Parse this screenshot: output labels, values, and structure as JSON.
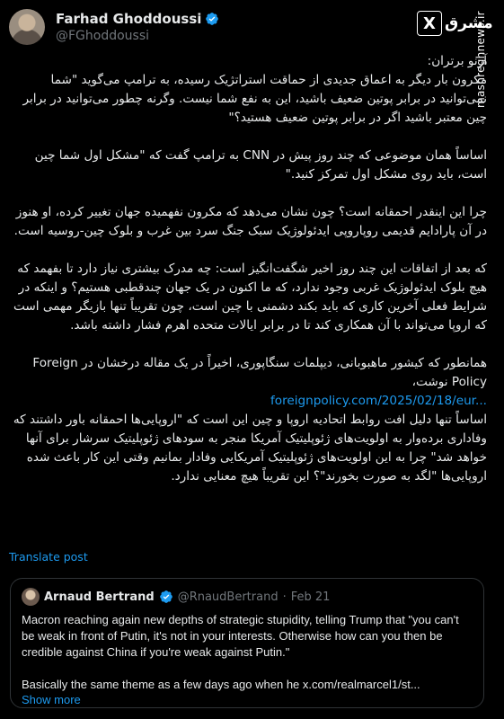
{
  "author": {
    "display_name": "Farhad Ghoddoussi",
    "handle": "@FGhoddoussi"
  },
  "watermark": {
    "x_logo": "X",
    "site_logo": "مشرق",
    "side_text": "mashreghnews.ir"
  },
  "tweet": {
    "paragraphs": [
      "آرنو برتران:",
      "مکرون بار دیگر به اعماق جدیدی از حماقت استراتژیک رسیده، به ترامپ می‌گوید \"شما نمی‌توانید در برابر پوتین ضعیف باشید، این به نفع شما نیست. وگرنه چطور می‌توانید در برابر چین معتبر باشید اگر در برابر پوتین ضعیف هستید؟\"",
      "اساساً همان موضوعی که چند روز پیش در CNN به ترامپ گفت که \"مشکل اول شما چین است، باید روی مشکل اول تمرکز کنید.\"",
      "چرا این اینقدر احمقانه است؟ چون نشان می‌دهد که مکرون نفهمیده جهان تغییر کرده، او هنوز در آن پارادایم قدیمی روپاروپی ایدئولوژیک سبک جنگ سرد بین غرب و بلوک چین-روسیه است.",
      "که بعد از اتفاقات این چند روز اخیر شگفت‌انگیز است: چه مدرک بیشتری نیاز دارد تا بفهمد که هیچ بلوک ایدئولوژیک غربی وجود ندارد، که ما اکنون در یک جهان چندقطبی هستیم؟ و اینکه در شرایط فعلی آخرین کاری که باید بکند دشمنی با چین است، چون تقریباً تنها بازیگر مهمی است که اروپا می‌تواند با آن همکاری کند تا در برابر ایالات متحده اهرم فشار داشته باشد.",
      "همانطور که کیشور ماهبوبانی، دیپلمات سنگاپوری، اخیراً در یک مقاله درخشان در Foreign Policy نوشت،",
      "اساساً تنها دلیل افت روابط اتحادیه اروپا و چین این است که \"اروپایی‌ها احمقانه باور داشتند که وفاداری برده‌وار به اولویت‌های ژئوپلیتیک آمریکا منجر به سودهای ژئوپلیتیک سرشار برای آنها خواهد شد\" چرا به این اولویت‌های ژئوپلیتیک آمریکایی وفادار بمانیم وقتی این کار باعث شده اروپایی‌ها \"لگد به صورت بخورند\"؟ این تقریباً هیچ معنایی ندارد."
    ],
    "link": "foreignpolicy.com/2025/02/18/eur...",
    "translate_label": "Translate post"
  },
  "quote": {
    "display_name": "Arnaud Bertrand",
    "handle": "@RnaudBertrand",
    "separator": "·",
    "date": "Feb 21",
    "paragraph_1": "Macron reaching again new depths of strategic stupidity, telling Trump that \"you can't be weak in front of Putin, it's not in your interests. Otherwise how can you then be credible against China if you're weak against Putin.\"",
    "paragraph_2": "Basically the same theme as a few days ago when he x.com/realmarcel1/st...",
    "show_more": "Show more"
  },
  "colors": {
    "background": "#000000",
    "text": "#e7e9ea",
    "muted": "#71767b",
    "link": "#1d9bf0",
    "verified": "#1d9bf0",
    "border": "#2f3336"
  },
  "icons": {
    "verified": "verified-badge-icon"
  }
}
